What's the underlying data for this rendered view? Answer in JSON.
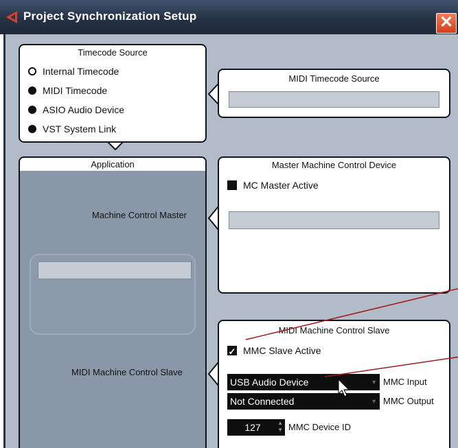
{
  "window": {
    "title": "Project Synchronization Setup",
    "close_symbol": "✕"
  },
  "timecode_source": {
    "title": "Timecode Source",
    "options": [
      {
        "label": "Internal Timecode",
        "selected": true
      },
      {
        "label": "MIDI Timecode",
        "selected": false
      },
      {
        "label": "ASIO Audio Device",
        "selected": false
      },
      {
        "label": "VST System Link",
        "selected": false
      }
    ]
  },
  "midi_timecode_source": {
    "title": "MIDI Timecode Source",
    "value": ""
  },
  "application": {
    "title": "Application",
    "machine_control_master_label": "Machine Control Master",
    "midi_machine_control_slave_label": "MIDI Machine Control Slave",
    "inner_field_value": ""
  },
  "master_machine_control": {
    "title": "Master Machine Control Device",
    "checkbox_label": "MC Master Active",
    "checked": false,
    "device_value": ""
  },
  "mmc_slave": {
    "title": "MIDI Machine Control Slave",
    "checkbox_label": "MMC Slave Active",
    "checked": true,
    "input_value": "USB Audio Device",
    "input_label": "MMC Input",
    "output_value": "Not Connected",
    "output_label": "MMC Output",
    "device_id_value": "127",
    "device_id_label": "MMC Device ID"
  },
  "colors": {
    "titlebar": "#253246",
    "body": "#b2bbc8",
    "app_panel": "#8a97a8",
    "annotation": "#9e1c1c"
  }
}
